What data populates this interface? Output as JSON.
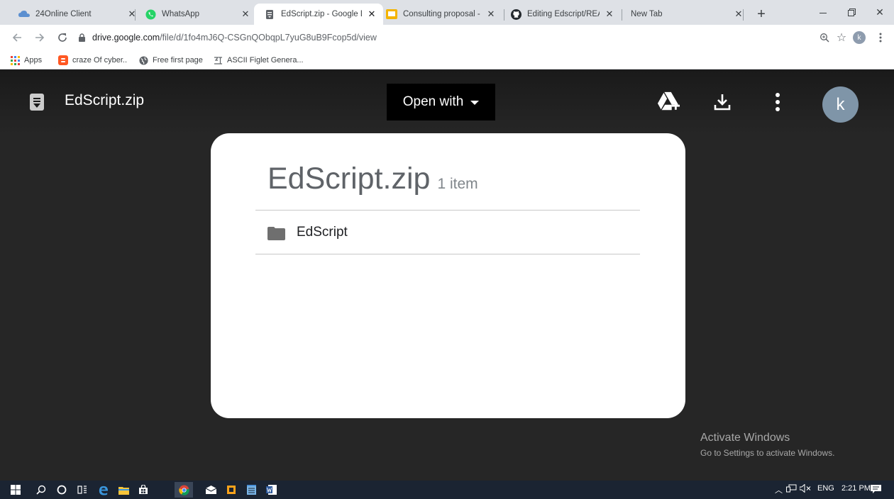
{
  "browser": {
    "tabs": [
      {
        "label": "24Online Client",
        "icon": "cloud-icon"
      },
      {
        "label": "WhatsApp",
        "icon": "whatsapp-icon"
      },
      {
        "label": "EdScript.zip - Google D",
        "icon": "drive-doc-icon",
        "active": true
      },
      {
        "label": "Consulting proposal - C",
        "icon": "slides-icon"
      },
      {
        "label": "Editing Edscript/READM",
        "icon": "github-icon"
      },
      {
        "label": "New Tab",
        "icon": ""
      }
    ],
    "url_host": "drive.google.com",
    "url_path": "/file/d/1fo4mJ6Q-CSGnQObqpL7yuG8uB9Fcop5d/view",
    "profile_initial": "k",
    "bookmarks": [
      {
        "label": "Apps",
        "icon": "apps-grid-icon"
      },
      {
        "label": "craze Of cyber..",
        "icon": "blogger-icon"
      },
      {
        "label": "Free first page",
        "icon": "globe-icon"
      },
      {
        "label": "ASCII Figlet Genera...",
        "icon": "figlet-icon"
      }
    ]
  },
  "viewer": {
    "file_name": "EdScript.zip",
    "open_with_label": "Open with",
    "avatar_initial": "k",
    "archive": {
      "name": "EdScript.zip",
      "count": "1 item",
      "items": [
        {
          "label": "EdScript",
          "icon": "folder-icon"
        }
      ]
    }
  },
  "watermark": {
    "line1": "Activate Windows",
    "line2": "Go to Settings to activate Windows."
  },
  "taskbar": {
    "language": "ENG",
    "time": "2:21 PM"
  },
  "colors": {
    "tabstrip": "#dee1e6",
    "viewer_bg": "#262626",
    "taskbar": "#1b2432",
    "avatar": "#7f95a8"
  }
}
